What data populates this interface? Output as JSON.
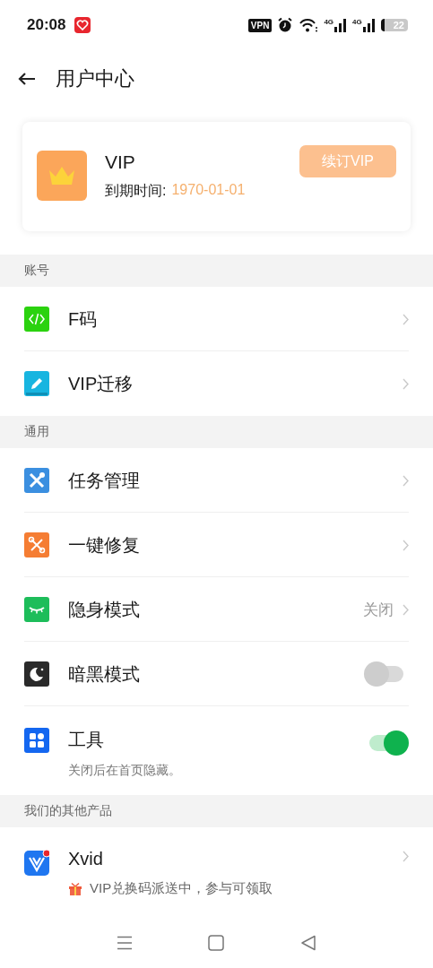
{
  "status_bar": {
    "time": "20:08",
    "vpn": "VPN",
    "networks": [
      "4G",
      "4G"
    ],
    "battery": "22"
  },
  "header": {
    "title": "用户中心"
  },
  "vip_card": {
    "title": "VIP",
    "expiry_label": "到期时间:",
    "expiry_date": "1970-01-01",
    "renew_button": "续订VIP"
  },
  "sections": [
    {
      "title": "账号",
      "items": [
        {
          "kind": "link",
          "label": "F码"
        },
        {
          "kind": "link",
          "label": "VIP迁移"
        }
      ]
    },
    {
      "title": "通用",
      "items": [
        {
          "kind": "link",
          "label": "任务管理"
        },
        {
          "kind": "link",
          "label": "一键修复"
        },
        {
          "kind": "link",
          "label": "隐身模式",
          "value": "关闭"
        },
        {
          "kind": "toggle",
          "label": "暗黑模式",
          "on": false
        },
        {
          "kind": "toggle",
          "label": "工具",
          "on": true,
          "description": "关闭后在首页隐藏。"
        }
      ]
    },
    {
      "title": "我们的其他产品",
      "items": [
        {
          "kind": "product",
          "label": "Xvid",
          "promo": "VIP兑换码派送中，参与可领取"
        }
      ]
    }
  ]
}
